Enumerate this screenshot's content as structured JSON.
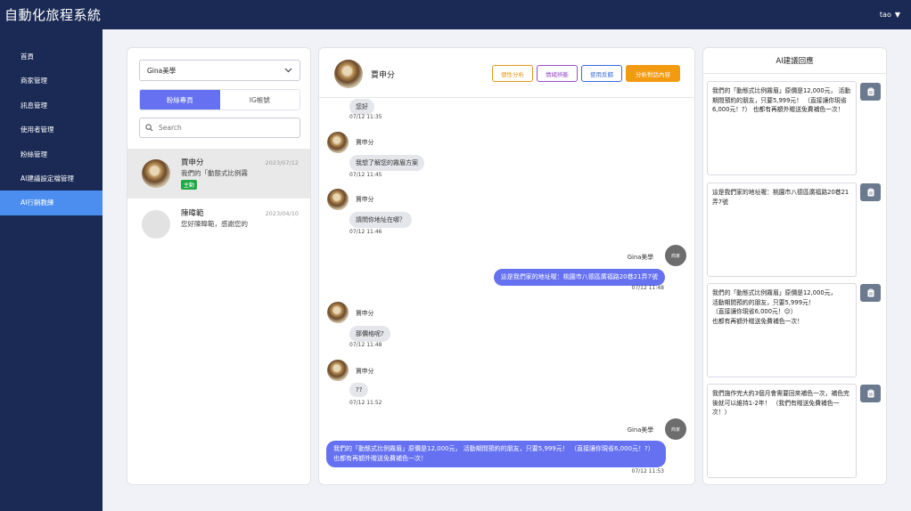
{
  "app": {
    "title": "自動化旅程系統",
    "user": "tao"
  },
  "sidebar": {
    "items": [
      {
        "label": "首頁"
      },
      {
        "label": "商家管理"
      },
      {
        "label": "訊息管理"
      },
      {
        "label": "使用者管理"
      },
      {
        "label": "粉絲管理"
      },
      {
        "label": "AI建議設定檔管理"
      },
      {
        "label": "AI行銷教練"
      }
    ],
    "active_index": 6
  },
  "left_panel": {
    "selected_store": "Gina美學",
    "tabs": [
      {
        "label": "粉絲專頁"
      },
      {
        "label": "IG帳號"
      }
    ],
    "active_tab": 0,
    "search_placeholder": "Search",
    "contacts": [
      {
        "name": "賈申分",
        "date": "2023/07/12",
        "preview": "我們的「動態式比例霧",
        "badge": "主動"
      },
      {
        "name": "陳暐範",
        "date": "2023/04/10",
        "preview": "您好陳暐範，感謝您的"
      }
    ]
  },
  "chat": {
    "contact_name": "賈申分",
    "actions": [
      {
        "label": "個性分析"
      },
      {
        "label": "情緒辨斷"
      },
      {
        "label": "使用反饋"
      },
      {
        "label": "分析對話內容"
      }
    ],
    "shop_avatar_label": "商家",
    "messages": [
      {
        "dir": "in",
        "sender": "",
        "text": "您好",
        "time": "07/12 11:35"
      },
      {
        "dir": "in",
        "sender": "賈申分",
        "text": "我想了解您的霧眉方案",
        "time": "07/12 11:45"
      },
      {
        "dir": "in",
        "sender": "賈申分",
        "text": "請問你地址在哪？",
        "time": "07/12 11:46"
      },
      {
        "dir": "out",
        "sender": "Gina美學",
        "text": "這是我們家的地址喔：桃園市八德區廣福路20巷21弄7號",
        "time": "07/12 11:48"
      },
      {
        "dir": "in",
        "sender": "賈申分",
        "text": "那價格呢?",
        "time": "07/12 11:48"
      },
      {
        "dir": "in",
        "sender": "賈申分",
        "text": "??",
        "time": "07/12 11:52"
      },
      {
        "dir": "out",
        "sender": "Gina美學",
        "text": "我們的「動態式比例霧眉」原價是12,000元，  活動期間預約的朋友，只要5,999元！ （直接讓你現省6,000元！?）  也都有再額外贈送免費補色一次！",
        "time": "07/12 11:53"
      }
    ]
  },
  "ai_panel": {
    "title": "AI建議回應",
    "suggestions": [
      {
        "text": "我們的「動態式比例霧眉」原價是12,000元，  活動期間預約的朋友，只要5,999元！ （直接讓你現省6,000元！?）  也都有再額外贈送免費補色一次！"
      },
      {
        "text": "這是我們家的地址喔：桃園市八德區廣福路20巷21弄7號"
      },
      {
        "text": "我們的「動態式比例霧眉」原價是12,000元，\n活動期間預約的朋友，只要5,999元！\n（直接讓你現省6,000元！😉）\n也都有再額外贈送免費補色一次！"
      },
      {
        "text": "我們施作完大約3個月會需要回來補色一次，補色完後就可以維持1-2年！ （我們有贈送免費補色一次！）"
      }
    ]
  },
  "colors": {
    "topbar": "#1a2a55",
    "active_nav": "#4c8ef0",
    "primary": "#6571f0",
    "badge": "#22a845",
    "analyze_button": "#f29b11"
  }
}
